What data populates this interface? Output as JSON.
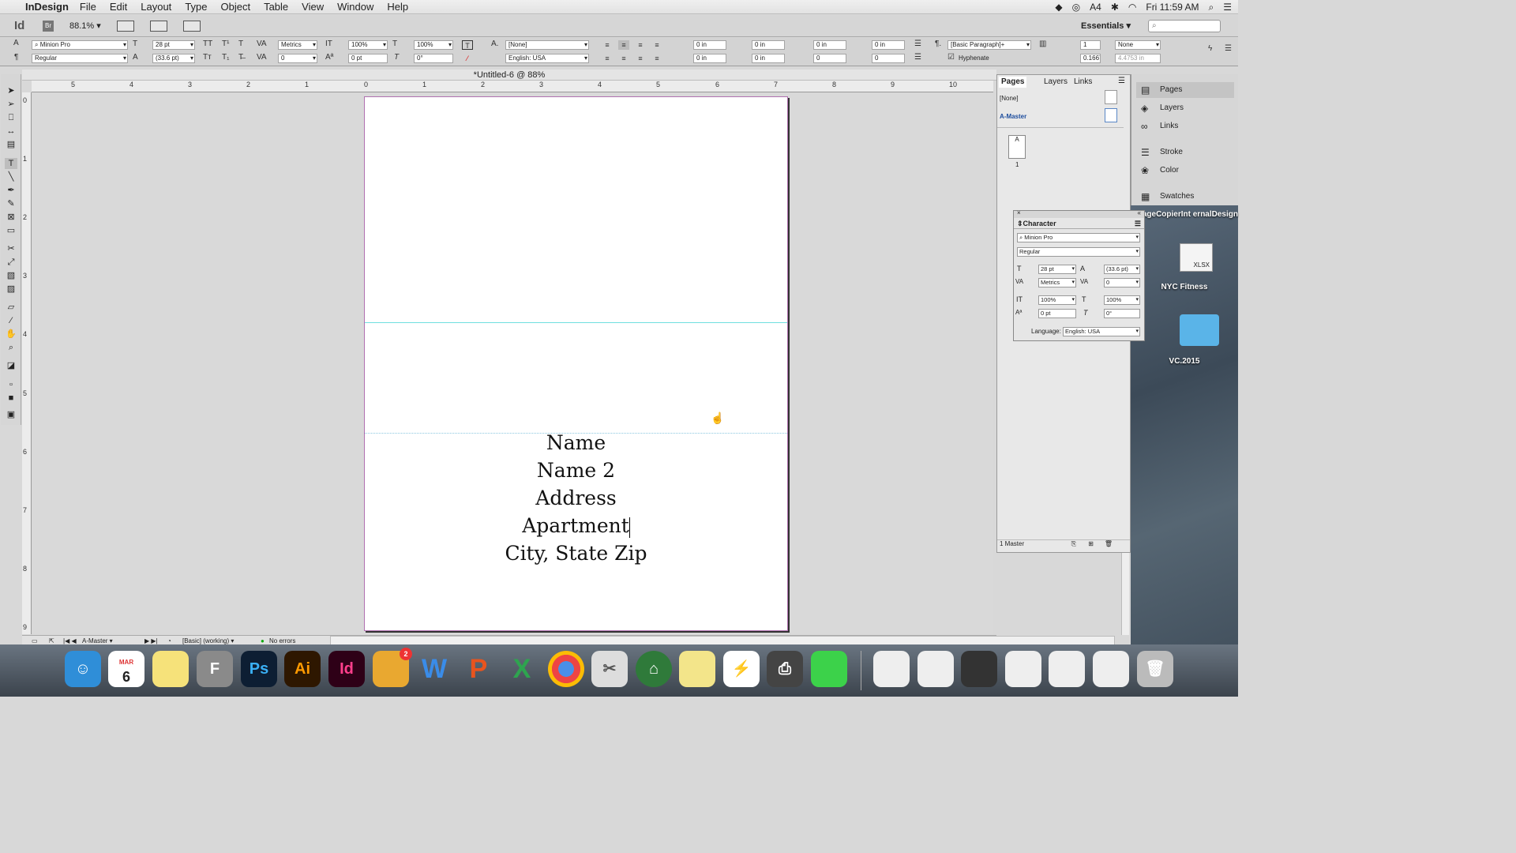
{
  "menubar": {
    "app": "InDesign",
    "items": [
      "File",
      "Edit",
      "Layout",
      "Type",
      "Object",
      "Table",
      "View",
      "Window",
      "Help"
    ],
    "adobe_count": "4",
    "clock": "Fri 11:59 AM"
  },
  "appbar": {
    "logo": "Id",
    "bridge": "Br",
    "zoom": "88.1%",
    "workspace": "Essentials"
  },
  "control": {
    "font": "Minion Pro",
    "style": "Regular",
    "size": "28 pt",
    "leading": "(33.6 pt)",
    "kerning": "Metrics",
    "tracking": "0",
    "vscale": "100%",
    "hscale": "100%",
    "baseline": "0 pt",
    "skew": "0°",
    "charstyle": "[None]",
    "language": "English: USA",
    "indent_l": "0 in",
    "indent_r": "0 in",
    "first": "0 in",
    "last": "0 in",
    "space_before": "0 in",
    "space_after": "0 in",
    "dropcap": "0",
    "dropcap_chars": "0",
    "pstyle": "[Basic Paragraph]+",
    "hyphenate": "Hyphenate",
    "cols": "1",
    "cols_none": "None",
    "gutter": "0.1667",
    "width_val": "4.4753 in"
  },
  "document": {
    "title": "*Untitled-6 @ 88%",
    "address_lines": [
      "Name",
      "Name 2",
      "Address",
      "Apartment",
      "City, State Zip"
    ]
  },
  "rulers": {
    "h": [
      "5",
      "4",
      "3",
      "2",
      "1",
      "0",
      "1",
      "2",
      "3",
      "4",
      "5",
      "6",
      "7",
      "8",
      "9",
      "10"
    ],
    "v": [
      "0",
      "1",
      "2",
      "3",
      "4",
      "5",
      "6",
      "7",
      "8",
      "9"
    ]
  },
  "status": {
    "master": "A-Master",
    "style": "[Basic] (working)",
    "preflight": "No errors"
  },
  "pages_panel": {
    "tabs": [
      "Pages",
      "Layers",
      "Links"
    ],
    "none": "[None]",
    "master": "A-Master",
    "thumb_letter": "A",
    "page_num": "1",
    "footer": "1 Master"
  },
  "dock_panels": [
    "Pages",
    "Layers",
    "Links",
    "Stroke",
    "Color",
    "Swatches"
  ],
  "character_panel": {
    "title": "Character",
    "font": "Minion Pro",
    "style": "Regular",
    "size": "28 pt",
    "leading": "(33.6 pt)",
    "kerning": "Metrics",
    "tracking": "0",
    "vscale": "100%",
    "hscale": "100%",
    "baseline": "0 pt",
    "skew": "0°",
    "language_label": "Language:",
    "language": "English: USA"
  },
  "desktop": {
    "items": [
      "VillageCopierInt ernalDesign",
      "NYC Fitness",
      "VC.2015"
    ],
    "file_badge": "XLSX"
  },
  "dock": {
    "calendar_month": "MAR",
    "calendar_day": "6",
    "mail_badge": "2",
    "apps": [
      "Ps",
      "Ai",
      "Id",
      "F",
      "W",
      "P",
      "X"
    ]
  }
}
